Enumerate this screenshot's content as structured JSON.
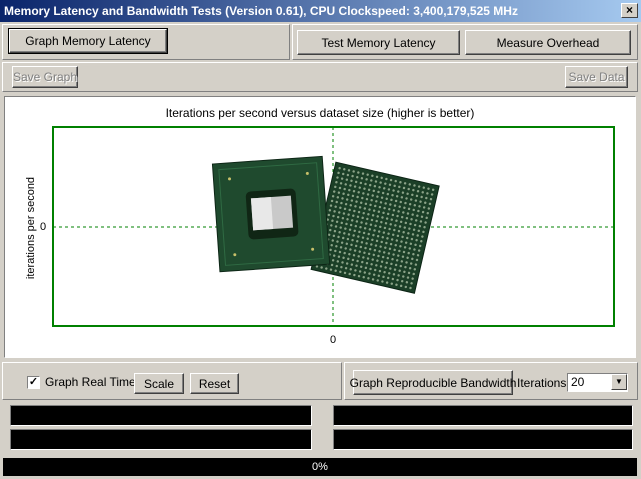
{
  "window": {
    "title": "Memory Latency and Bandwidth Tests (Version 0.61), CPU Clockspeed: 3,400,179,525 MHz",
    "close_glyph": "×"
  },
  "toolbar": {
    "graph_memory_latency": "Graph Memory Latency",
    "test_memory_latency": "Test Memory Latency",
    "measure_overhead": "Measure Overhead",
    "save_graph": "Save Graph",
    "save_data": "Save Data"
  },
  "chart": {
    "title": "Iterations per second versus dataset size (higher is better)",
    "y_axis_label": "iterations per second",
    "y_zero_label": "0",
    "x_zero_label": "0"
  },
  "chart_data": {
    "type": "line",
    "title": "Iterations per second versus dataset size (higher is better)",
    "xlabel": "",
    "ylabel": "iterations per second",
    "x_tick_labels": [
      "0"
    ],
    "y_tick_labels": [
      "0"
    ],
    "series": [],
    "grid": false
  },
  "controls": {
    "graph_real_time_label": "Graph Real Time",
    "graph_real_time_checked": true,
    "check_glyph": "✓",
    "scale": "Scale",
    "reset": "Reset",
    "graph_reproducible_bandwidth": "Graph Reproducible Bandwidth",
    "iterations_label": "Iterations:",
    "iterations_value": "20"
  },
  "status": {
    "progress_text": "0%",
    "progress_fraction": 0
  },
  "colors": {
    "plot_axis": "#008000",
    "chip_substrate": "#1e4a2e"
  },
  "icons": {
    "dropdown": "chevron-down-icon"
  }
}
